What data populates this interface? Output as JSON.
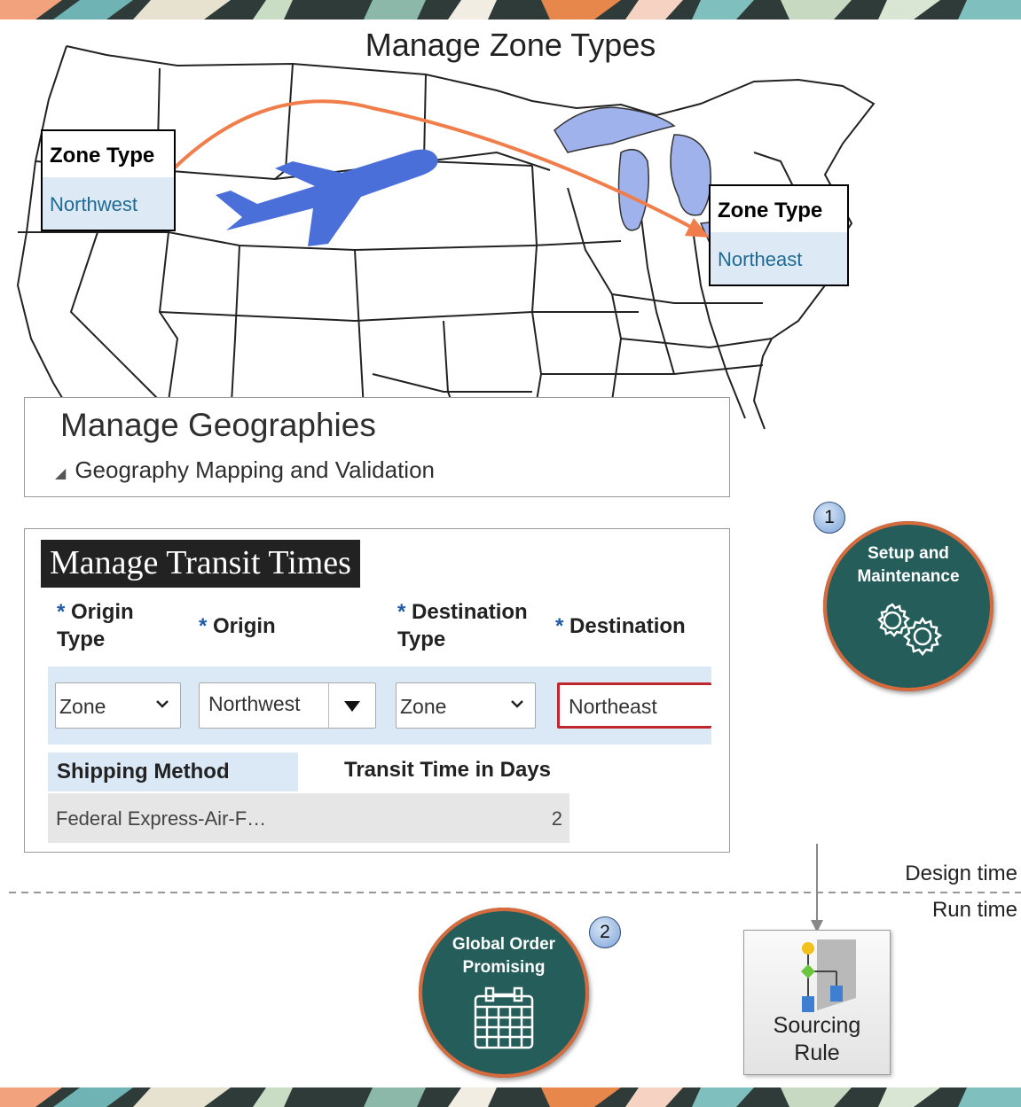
{
  "zone_types": {
    "title": "Manage Zone Types",
    "left_box": {
      "header": "Zone Type",
      "value": "Northwest"
    },
    "right_box": {
      "header": "Zone Type",
      "value": "Northeast"
    }
  },
  "geographies": {
    "title": "Manage Geographies",
    "subtitle": "Geography Mapping and Validation"
  },
  "transit_times": {
    "title": "Manage Transit Times",
    "required_marker": "*",
    "columns": {
      "origin_type_line1": "Origin",
      "origin_type_line2": "Type",
      "origin": "Origin",
      "destination_type_line1": "Destination",
      "destination_type_line2": "Type",
      "destination": "Destination"
    },
    "fields": {
      "origin_type": "Zone",
      "origin": "Northwest",
      "destination_type": "Zone",
      "destination": "Northeast"
    },
    "table": {
      "headers": [
        "Shipping Method",
        "Transit Time in Days"
      ],
      "rows": [
        {
          "shipping_method": "Federal Express-Air-F…",
          "transit_time": "2"
        }
      ]
    }
  },
  "setup": {
    "badge": "1",
    "line1": "Setup and",
    "line2": "Maintenance"
  },
  "gop": {
    "badge": "2",
    "line1": "Global Order",
    "line2": "Promising"
  },
  "sourcing_rule": {
    "line1": "Sourcing",
    "line2": "Rule"
  },
  "timeline": {
    "design_time": "Design time",
    "run_time": "Run time"
  },
  "colors": {
    "teal": "#245d5a",
    "orange": "#d66b3e",
    "arrow": "#f07d4a",
    "plane": "#4a6fd8",
    "lakes": "#9fb2ec",
    "selected_row": "#dbe9f7",
    "link_text": "#1f6a94",
    "error_border": "#c0262d"
  },
  "icons": [
    "airplane-icon",
    "gears-icon",
    "calendar-icon",
    "sourcing-rule-icon",
    "dropdown-chevron-icon",
    "lov-search-icon",
    "disclosure-triangle-icon"
  ]
}
